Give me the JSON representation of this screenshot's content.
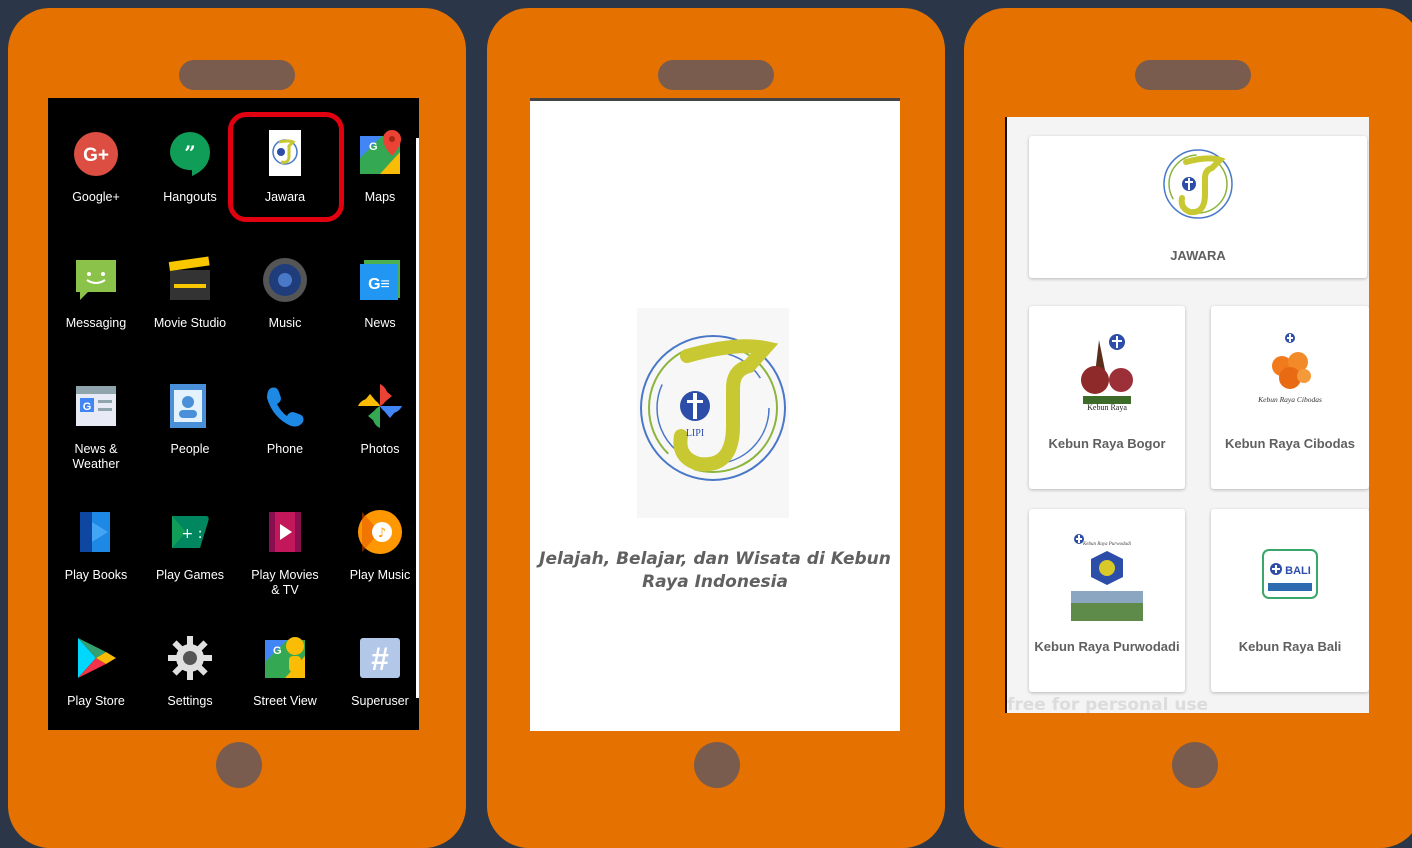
{
  "launcher": {
    "apps": [
      {
        "label": "Google+",
        "icon": "google-plus-icon"
      },
      {
        "label": "Hangouts",
        "icon": "hangouts-icon"
      },
      {
        "label": "Jawara",
        "icon": "jawara-icon"
      },
      {
        "label": "Maps",
        "icon": "maps-icon"
      },
      {
        "label": "Messaging",
        "icon": "messaging-icon"
      },
      {
        "label": "Movie Studio",
        "icon": "movie-studio-icon"
      },
      {
        "label": "Music",
        "icon": "music-icon"
      },
      {
        "label": "News",
        "icon": "news-icon"
      },
      {
        "label": "News &\nWeather",
        "icon": "news-weather-icon"
      },
      {
        "label": "People",
        "icon": "people-icon"
      },
      {
        "label": "Phone",
        "icon": "phone-icon"
      },
      {
        "label": "Photos",
        "icon": "photos-icon"
      },
      {
        "label": "Play Books",
        "icon": "play-books-icon"
      },
      {
        "label": "Play Games",
        "icon": "play-games-icon"
      },
      {
        "label": "Play Movies\n& TV",
        "icon": "play-movies-icon"
      },
      {
        "label": "Play Music",
        "icon": "play-music-icon"
      },
      {
        "label": "Play Store",
        "icon": "play-store-icon"
      },
      {
        "label": "Settings",
        "icon": "settings-icon"
      },
      {
        "label": "Street View",
        "icon": "street-view-icon"
      },
      {
        "label": "Superuser",
        "icon": "superuser-icon"
      }
    ],
    "highlighted_app": "Jawara"
  },
  "splash": {
    "logo_text": "LIPI",
    "tagline": "Jelajah, Belajar, dan Wisata di Kebun Raya Indonesia"
  },
  "menu": {
    "header_label": "JAWARA",
    "cards": [
      {
        "label": "Kebun Raya Bogor",
        "logo_text": "Kebun Raya"
      },
      {
        "label": "Kebun Raya Cibodas",
        "logo_text": "Kebun Raya Cibodas"
      },
      {
        "label": "Kebun Raya Purwodadi",
        "logo_text": "Kebun Raya Purwodadi"
      },
      {
        "label": "Kebun Raya Bali",
        "logo_text": "BALI"
      }
    ],
    "watermark": "free for personal use"
  },
  "colors": {
    "phone_body": "#e57200",
    "background": "#2b3748",
    "highlight": "#e0000f"
  }
}
